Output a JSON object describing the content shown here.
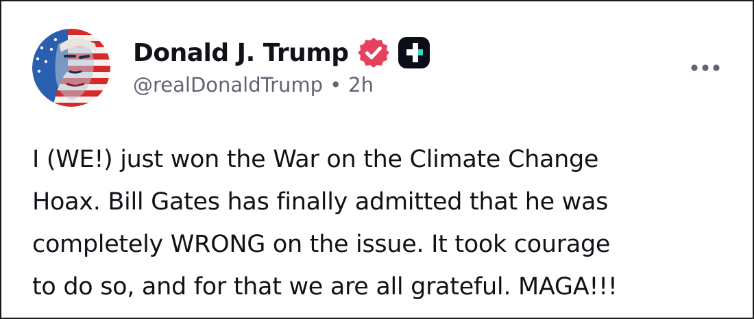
{
  "post": {
    "author": {
      "display_name": "Donald J. Trump",
      "handle": "@realDonaldTrump",
      "verified_icon": "verified-badge-icon",
      "platform_icon": "truth-social-icon",
      "avatar_icon": "profile-avatar"
    },
    "separator": "•",
    "timestamp": "2h",
    "more_icon": "more-options-icon",
    "body_lines": [
      "I (WE!) just won the War on the Climate Change",
      "Hoax. Bill Gates has finally admitted that he was",
      "completely WRONG on the issue. It took courage",
      "to do so, and for that we are all grateful. MAGA!!!"
    ]
  },
  "colors": {
    "text_primary": "#111218",
    "text_secondary": "#606473",
    "verified_badge": "#e5415e",
    "platform_badge": "#0b0d17",
    "platform_accent": "#3fd6c2",
    "border": "#1a1a1a"
  }
}
